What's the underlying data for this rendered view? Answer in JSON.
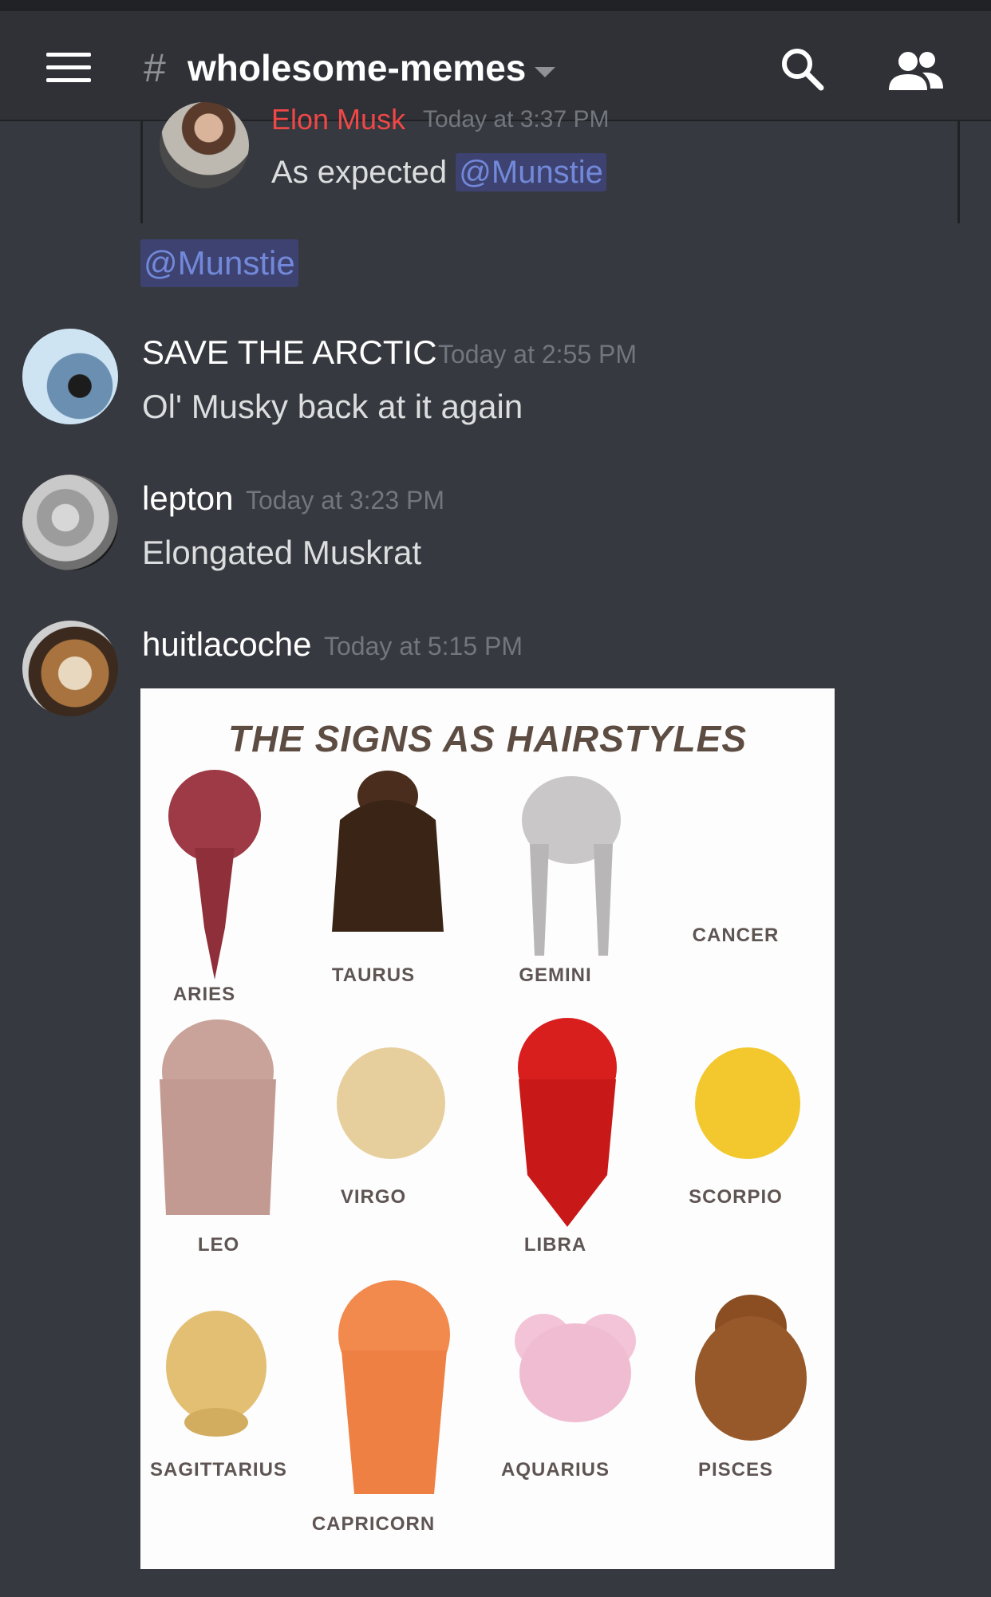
{
  "header": {
    "hash": "#",
    "channel": "wholesome-memes"
  },
  "reply": {
    "author": "Elon Musk",
    "time": "Today at 3:37 PM",
    "text": "As expected",
    "mention": "@Munstie"
  },
  "standalone_mention": "@Munstie",
  "messages": [
    {
      "author": "SAVE THE ARCTIC",
      "time": "Today at 2:55 PM",
      "text": "Ol' Musky back at it again"
    },
    {
      "author": "lepton",
      "time": "Today at 3:23 PM",
      "text": "Elongated Muskrat"
    },
    {
      "author": "huitlacoche",
      "time": "Today at 5:15 PM",
      "text": ""
    }
  ],
  "meme": {
    "title": "THE SIGNS AS HAIRSTYLES",
    "signs": [
      "ARIES",
      "TAURUS",
      "GEMINI",
      "CANCER",
      "LEO",
      "VIRGO",
      "LIBRA",
      "SCORPIO",
      "SAGITTARIUS",
      "CAPRICORN",
      "AQUARIUS",
      "PISCES"
    ]
  },
  "colors": {
    "background": "#36393f",
    "header": "#2f3136",
    "mention_bg": "#3e4271",
    "mention_text": "#7289da",
    "reply_author": "#f04747"
  }
}
